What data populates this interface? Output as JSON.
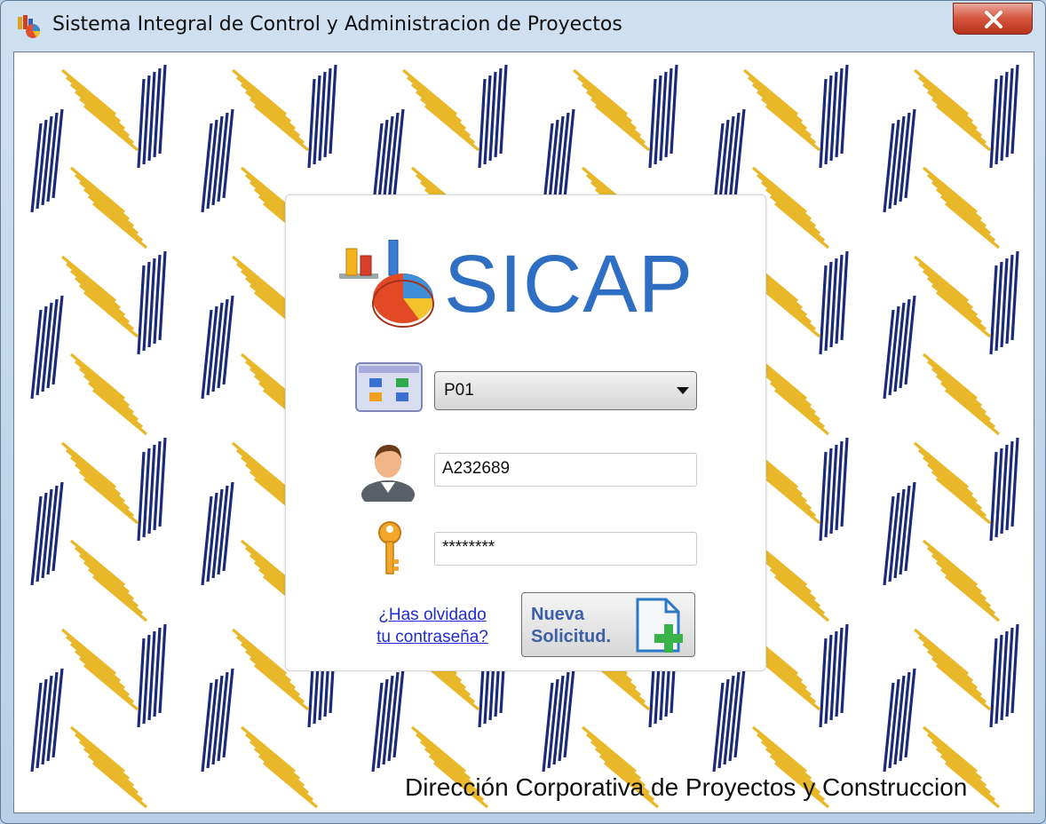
{
  "window": {
    "title": "Sistema Integral de Control y Administracion de Proyectos",
    "close_icon": "close-icon",
    "app_icon": "chart-app-icon"
  },
  "login": {
    "logo_text": "SICAP",
    "logo_icon": "chart-pie-logo-icon",
    "project_select": {
      "value": "P01",
      "icon": "project-grid-icon"
    },
    "username": {
      "value": "A232689",
      "icon": "user-icon"
    },
    "password": {
      "value": "********",
      "icon": "key-icon"
    },
    "forgot_link": "¿Has olvidado tu contraseña?",
    "forgot_line1": "¿Has olvidado",
    "forgot_line2": "tu contraseña?",
    "new_request_line1": "Nueva",
    "new_request_line2": "Solicitud.",
    "new_request_icon": "document-add-icon"
  },
  "footer": "Dirección Corporativa de Proyectos y Construccion",
  "colors": {
    "brand_blue": "#2e6fc4",
    "pattern_gold": "#e8b82a",
    "pattern_navy": "#1a2a7a",
    "link": "#1f2bd6"
  }
}
